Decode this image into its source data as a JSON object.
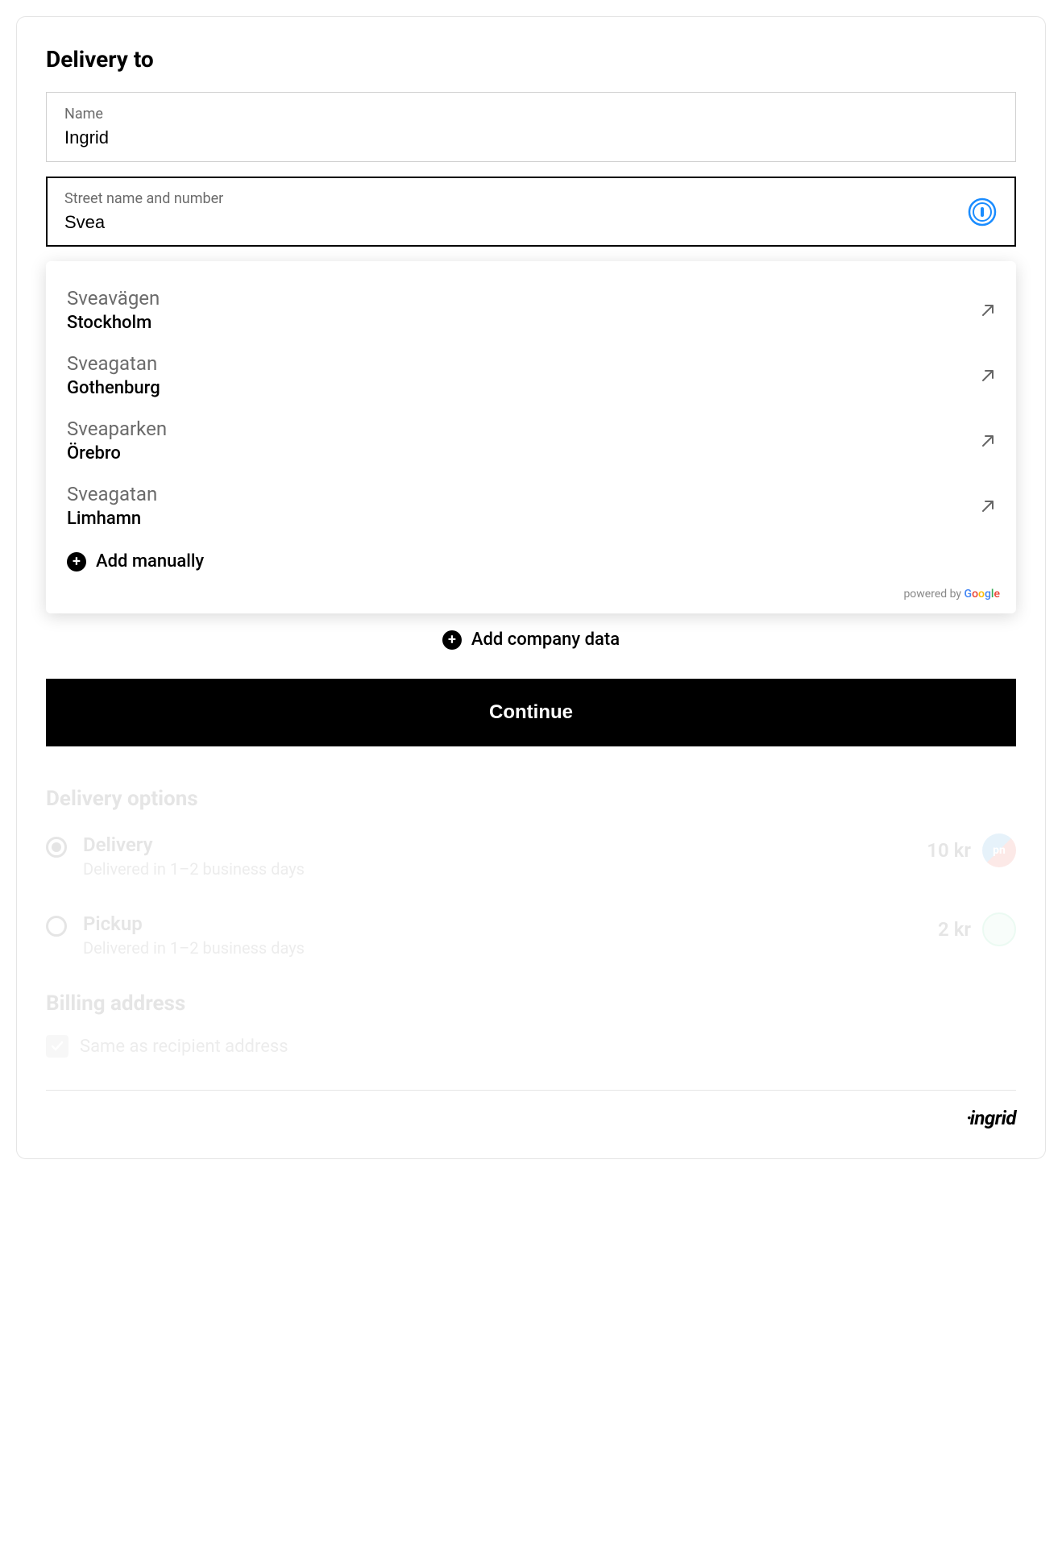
{
  "delivery_to": {
    "title": "Delivery to",
    "name_label": "Name",
    "name_value": "Ingrid",
    "street_label": "Street name and number",
    "street_value": "Svea"
  },
  "suggestions": [
    {
      "street": "Sveavägen",
      "city": "Stockholm"
    },
    {
      "street": "Sveagatan",
      "city": "Gothenburg"
    },
    {
      "street": "Sveaparken",
      "city": "Örebro"
    },
    {
      "street": "Sveagatan",
      "city": "Limhamn"
    }
  ],
  "add_manually": "Add manually",
  "powered_by": "powered by",
  "add_company": "Add company data",
  "continue": "Continue",
  "delivery_options": {
    "title": "Delivery options",
    "options": [
      {
        "title": "Delivery",
        "subtitle": "Delivered in 1–2 business days",
        "price": "10 kr",
        "selected": true,
        "carrier": "pn"
      },
      {
        "title": "Pickup",
        "subtitle": "Delivered in 1–2 business days",
        "price": "2 kr",
        "selected": false,
        "carrier": "green"
      }
    ]
  },
  "billing": {
    "title": "Billing address",
    "same_label": "Same as recipient address"
  },
  "brand": "ingrid"
}
